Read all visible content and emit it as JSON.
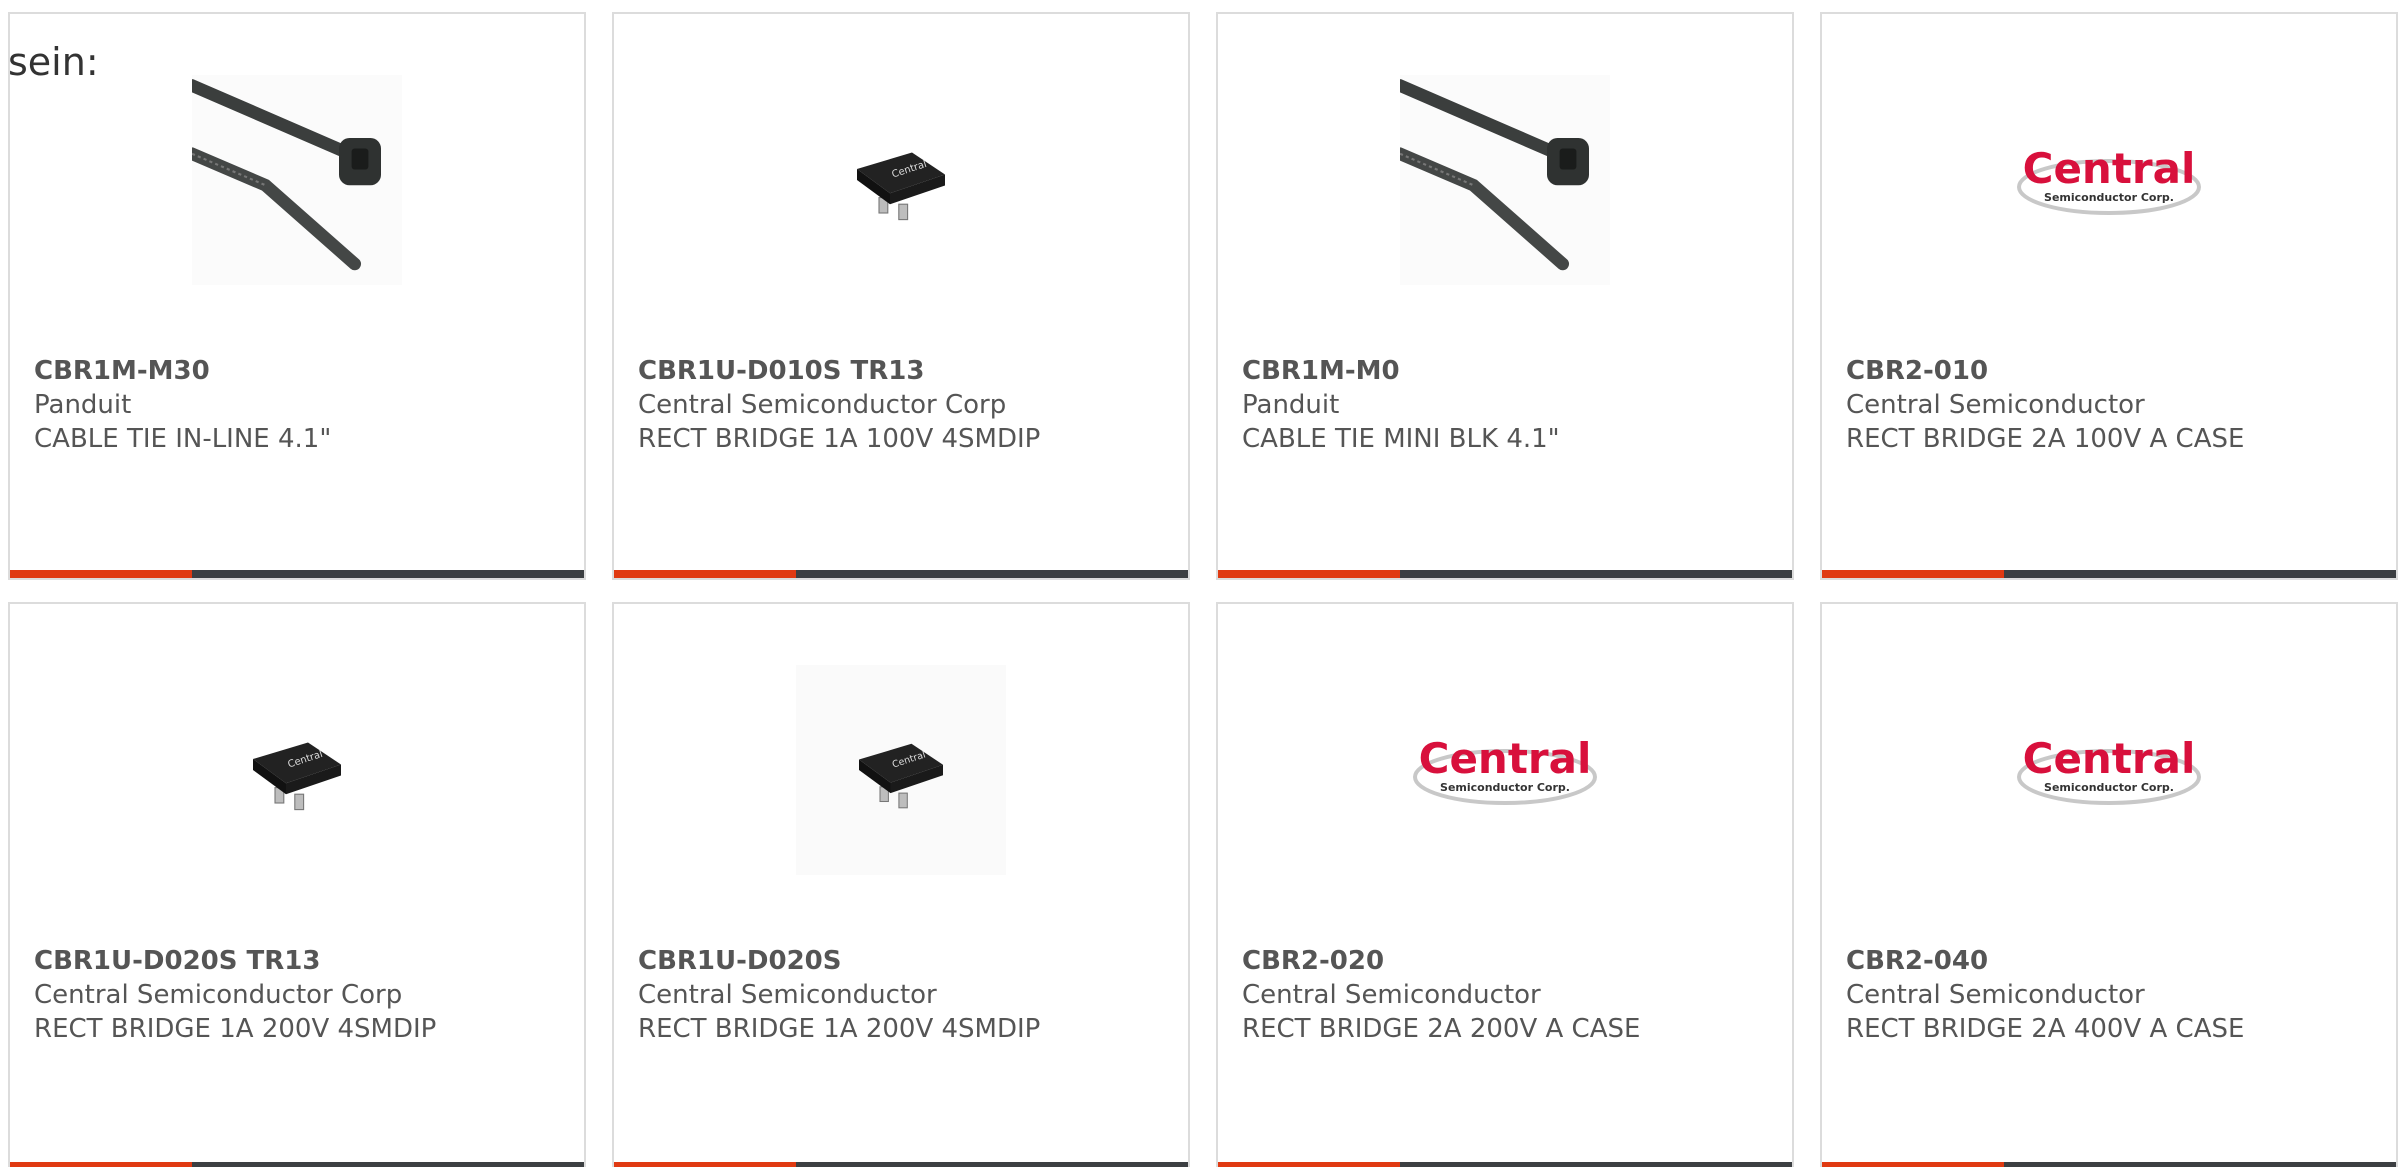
{
  "intro": {
    "text": "sein:"
  },
  "colors": {
    "accent": "#e03a12",
    "bar_dark": "#3c3f42",
    "logo_red": "#d8103c"
  },
  "products": [
    {
      "part_number": "CBR1M-M30",
      "manufacturer": "Panduit",
      "description": "CABLE TIE IN-LINE 4.1\"",
      "image": "cable-tie-image"
    },
    {
      "part_number": "CBR1U-D010S TR13",
      "manufacturer": "Central Semiconductor Corp",
      "description": "RECT BRIDGE 1A 100V 4SMDIP",
      "image": "smd-chip-image"
    },
    {
      "part_number": "CBR1M-M0",
      "manufacturer": "Panduit",
      "description": "CABLE TIE MINI BLK 4.1\"",
      "image": "cable-tie-image"
    },
    {
      "part_number": "CBR2-010",
      "manufacturer": "Central Semiconductor",
      "description": "RECT BRIDGE 2A 100V A CASE",
      "image": "central-logo-image"
    },
    {
      "part_number": "CBR1U-D020S TR13",
      "manufacturer": "Central Semiconductor Corp",
      "description": "RECT BRIDGE 1A 200V 4SMDIP",
      "image": "smd-chip-image"
    },
    {
      "part_number": "CBR1U-D020S",
      "manufacturer": "Central Semiconductor",
      "description": "RECT BRIDGE 1A 200V 4SMDIP",
      "image": "smd-chip-image"
    },
    {
      "part_number": "CBR2-020",
      "manufacturer": "Central Semiconductor",
      "description": "RECT BRIDGE 2A 200V A CASE",
      "image": "central-logo-image"
    },
    {
      "part_number": "CBR2-040",
      "manufacturer": "Central Semiconductor",
      "description": "RECT BRIDGE 2A 400V A CASE",
      "image": "central-logo-image"
    }
  ],
  "logo": {
    "brand": "Central",
    "tagline": "Semiconductor Corp."
  }
}
